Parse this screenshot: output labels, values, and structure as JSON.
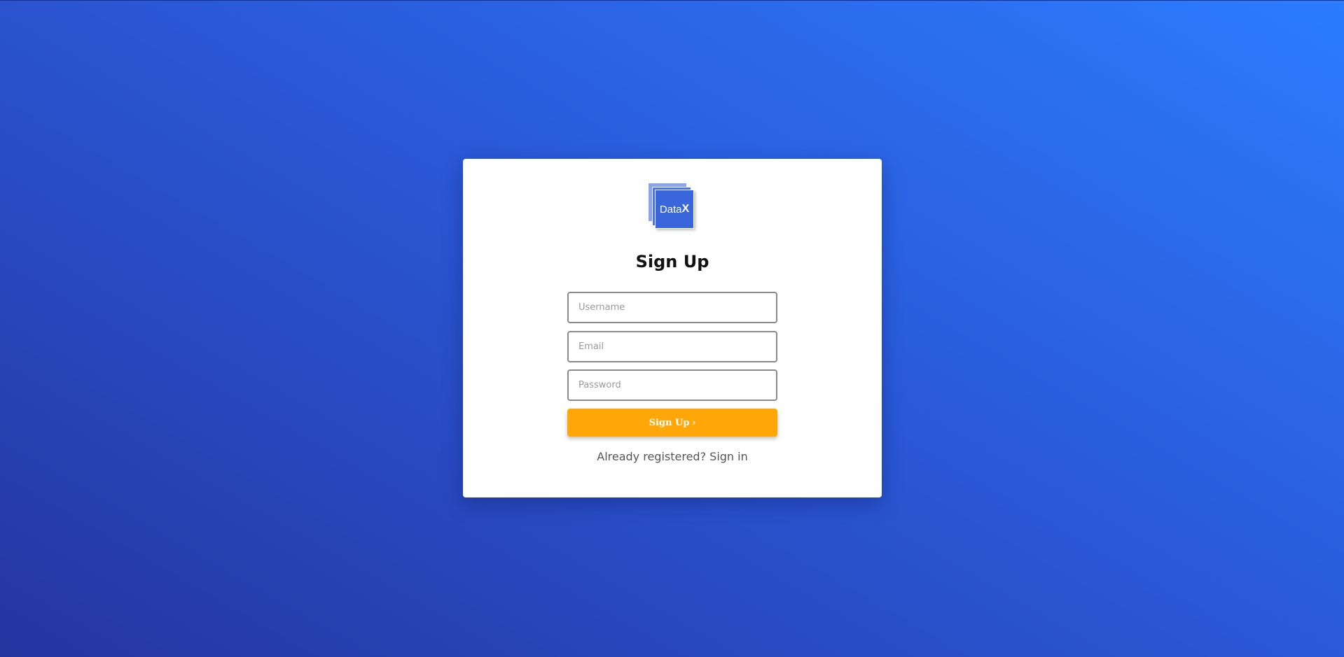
{
  "logo": {
    "text": "Data",
    "text_bold": "X"
  },
  "form": {
    "title": "Sign Up",
    "username_placeholder": "Username",
    "email_placeholder": "Email",
    "password_placeholder": "Password",
    "submit_label": "Sign Up",
    "submit_icon": "chevron-right-icon",
    "already_registered": "Already registered?",
    "signin_link": "Sign in"
  },
  "colors": {
    "background_start": "#2535a0",
    "background_end": "#2c7cff",
    "button": "#ffa708",
    "logo_blue": "#3a66dc"
  }
}
